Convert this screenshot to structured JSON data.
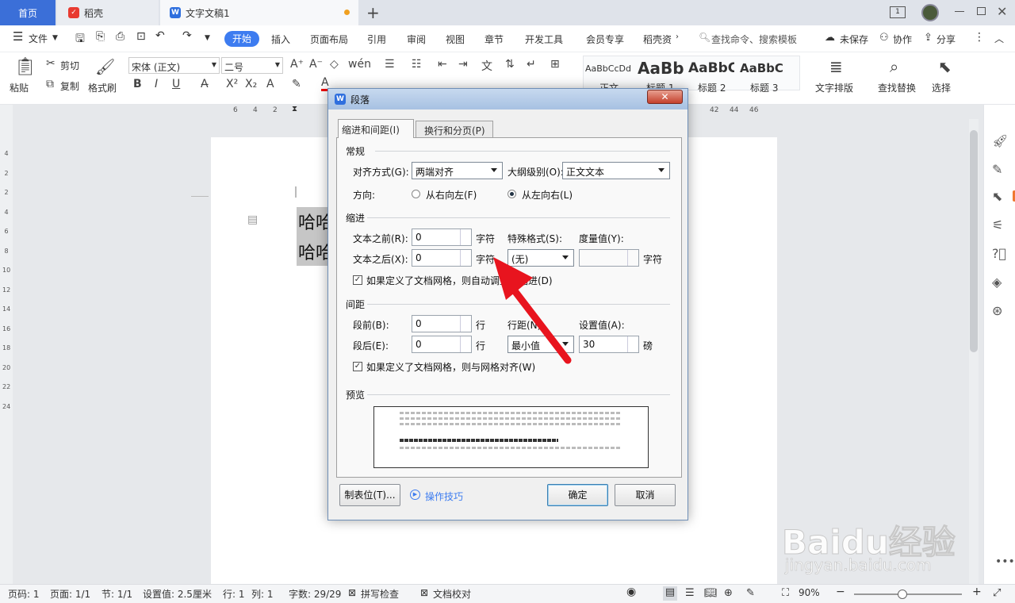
{
  "tabs": {
    "home": "首页",
    "daoke": "稻壳",
    "doc": "文字文稿1",
    "new_tab": "+"
  },
  "menu": {
    "file": "文件",
    "items": [
      "开始",
      "插入",
      "页面布局",
      "引用",
      "审阅",
      "视图",
      "章节",
      "开发工具",
      "会员专享",
      "稻壳资"
    ],
    "search_placeholder": "查找命令、搜索模板",
    "unsaved": "未保存",
    "collab": "协作",
    "share": "分享"
  },
  "ribbon": {
    "paste": "粘贴",
    "cut": "剪切",
    "copy": "复制",
    "format_painter": "格式刷",
    "font_name": "宋体 (正文)",
    "font_size": "二号",
    "styles": [
      {
        "preview": "AaBbCcDd",
        "label": "正文"
      },
      {
        "preview": "AaBb",
        "label": "标题 1"
      },
      {
        "preview": "AaBbC",
        "label": "标题 2"
      },
      {
        "preview": "AaBbC",
        "label": "标题 3"
      }
    ],
    "text_layout": "文字排版",
    "find_replace": "查找替换",
    "select": "选择"
  },
  "ruler": {
    "left": [
      "6",
      "4",
      "2"
    ],
    "right": [
      "42",
      "44",
      "46"
    ],
    "vertical": [
      "4",
      "2",
      "2",
      "4",
      "6",
      "8",
      "10",
      "12",
      "14",
      "16",
      "18",
      "20",
      "22",
      "24"
    ]
  },
  "doc": {
    "line1": "哈哈",
    "line2": "哈哈"
  },
  "dialog": {
    "title": "段落",
    "tabs": [
      "缩进和间距(I)",
      "换行和分页(P)"
    ],
    "section_general": "常规",
    "align_label": "对齐方式(G):",
    "align_value": "两端对齐",
    "outline_label": "大纲级别(O):",
    "outline_value": "正文文本",
    "direction_label": "方向:",
    "dir_rtl": "从右向左(F)",
    "dir_ltr": "从左向右(L)",
    "section_indent": "缩进",
    "before_text_label": "文本之前(R):",
    "before_text_value": "0",
    "unit_char": "字符",
    "special_label": "特殊格式(S):",
    "special_value": "(无)",
    "measure_label": "度量值(Y):",
    "measure_value": "",
    "after_text_label": "文本之后(X):",
    "after_text_value": "0",
    "auto_indent": "如果定义了文档网格，则自动调整右缩进(D)",
    "section_spacing": "间距",
    "before_label": "段前(B):",
    "before_value": "0",
    "unit_line": "行",
    "line_spacing_label": "行距(N):",
    "line_spacing_value": "最小值",
    "set_value_label": "设置值(A):",
    "set_value": "30",
    "unit_pt": "磅",
    "after_label": "段后(E):",
    "after_value": "0",
    "grid_align": "如果定义了文档网格，则与网格对齐(W)",
    "section_preview": "预览",
    "tab_stops": "制表位(T)...",
    "tips": "操作技巧",
    "ok": "确定",
    "cancel": "取消"
  },
  "status": {
    "page_no": "页码: 1",
    "pages": "页面: 1/1",
    "section": "节: 1/1",
    "setting": "设置值: 2.5厘米",
    "row": "行: 1",
    "col": "列: 1",
    "words": "字数: 29/29",
    "spell": "拼写检查",
    "proof": "文档校对",
    "zoom": "90%"
  },
  "watermark": {
    "brand": "Baidu经验",
    "url": "jingyan.baidu.com"
  },
  "colors": {
    "accent": "#3d7cf0",
    "arrow": "#e8141e",
    "home_tab": "#3b6fd8"
  }
}
